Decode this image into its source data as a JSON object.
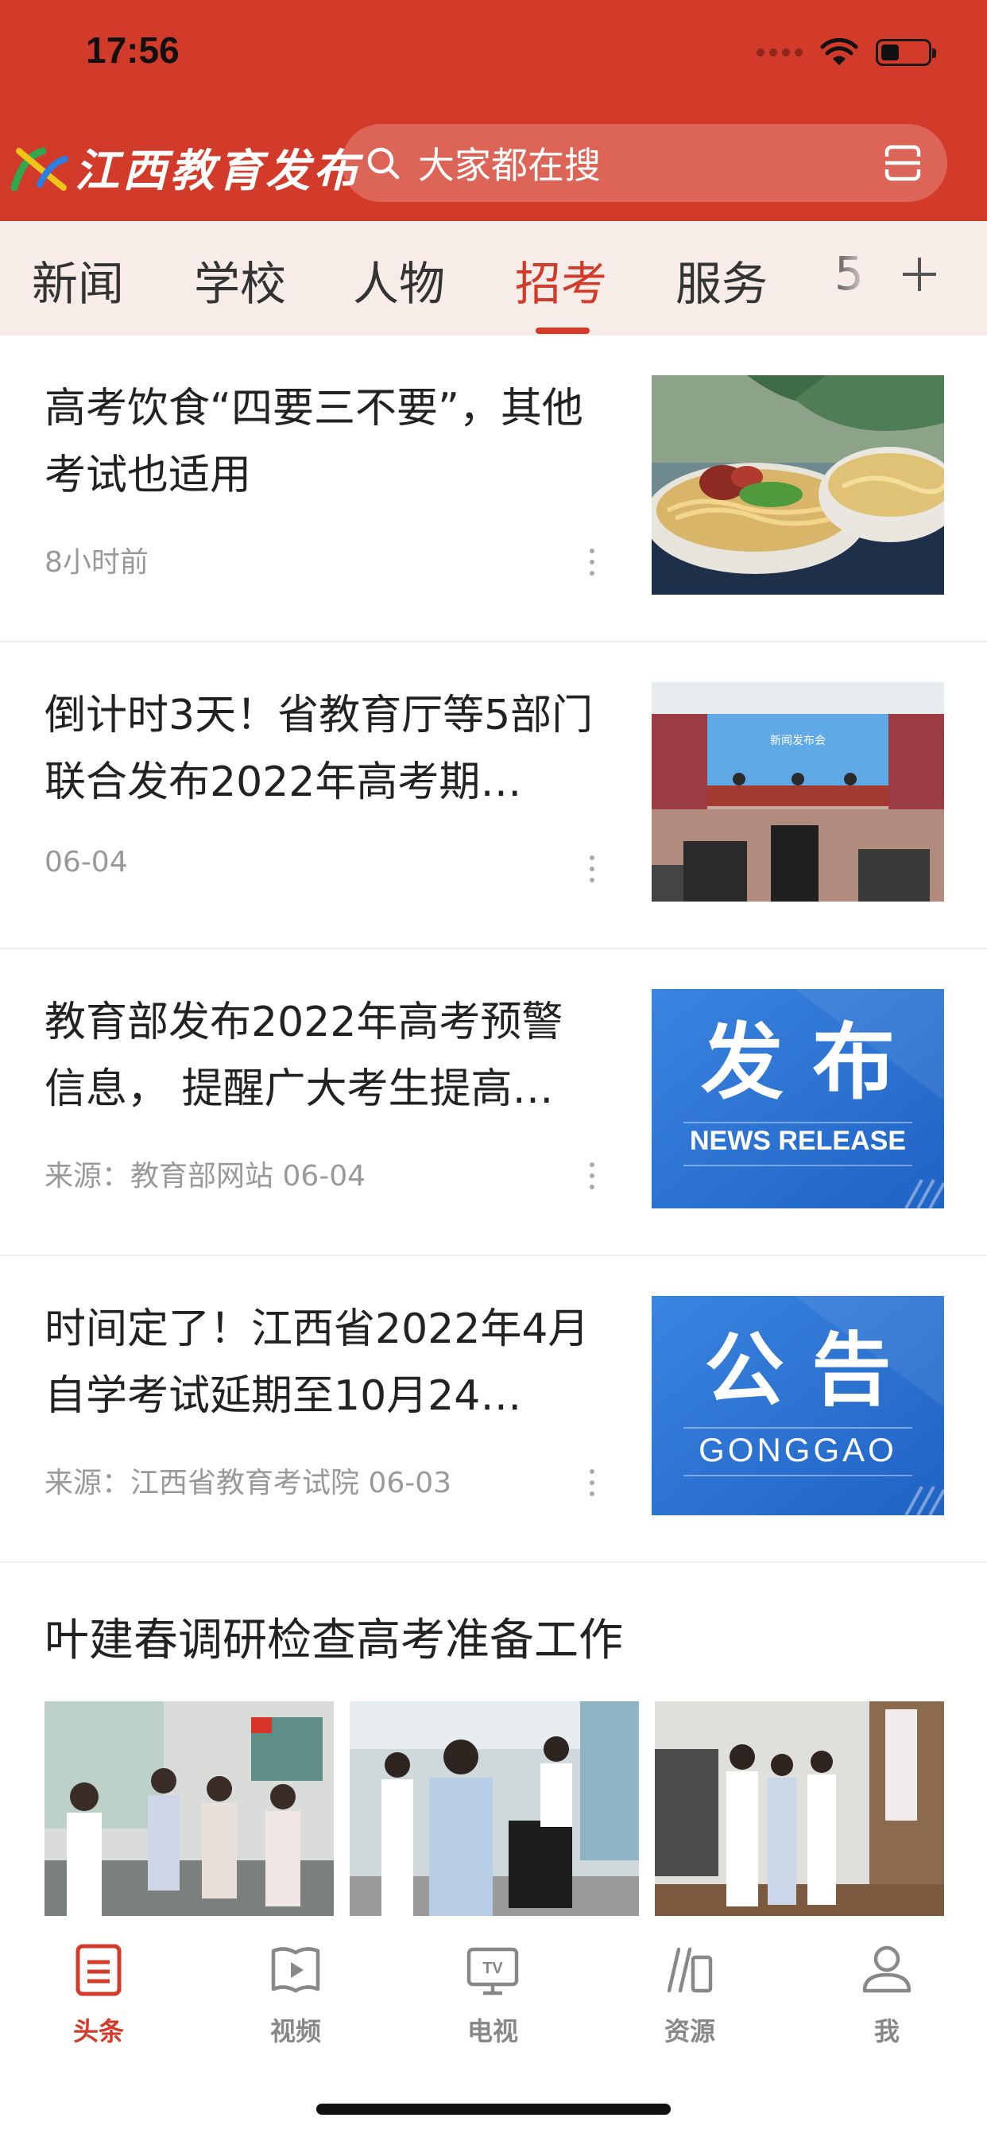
{
  "status_bar": {
    "time": "17:56"
  },
  "header": {
    "brand_name": "江西教育发布",
    "search": {
      "placeholder": "大家都在搜"
    }
  },
  "tabs": [
    {
      "label": "新闻"
    },
    {
      "label": "学校"
    },
    {
      "label": "人物"
    },
    {
      "label": "招考",
      "active": true
    },
    {
      "label": "服务"
    },
    {
      "label": "5"
    }
  ],
  "news": [
    {
      "title": "高考饮食“四要三不要”，其他考试也适用",
      "meta": "8小时前"
    },
    {
      "title": "倒计时3天！省教育厅等5部门联合发布2022年高考期…",
      "meta": "06-04"
    },
    {
      "title": "教育部发布2022年高考预警信息， 提醒广大考生提高…",
      "meta": "来源：教育部网站  06-04",
      "thumb": {
        "title": "发 布",
        "subtitle": "NEWS RELEASE"
      }
    },
    {
      "title": "时间定了！江西省2022年4月自学考试延期至10月24…",
      "meta": "来源：江西省教育考试院  06-03",
      "thumb": {
        "title": "公 告",
        "subtitle": "GONGGAO"
      }
    }
  ],
  "gallery": {
    "title": "叶建春调研检查高考准备工作"
  },
  "photo_text": {
    "press_banner": "新闻发布会"
  },
  "bottom_nav": [
    {
      "label": "头条",
      "icon": "article-icon",
      "active": true
    },
    {
      "label": "视频",
      "icon": "video-icon"
    },
    {
      "label": "电视",
      "icon": "tv-icon"
    },
    {
      "label": "资源",
      "icon": "books-icon"
    },
    {
      "label": "我",
      "icon": "person-icon"
    }
  ],
  "colors": {
    "brand_red": "#d23a2a",
    "tab_bg": "#f7ece8",
    "release_blue": "#2b73d4"
  }
}
